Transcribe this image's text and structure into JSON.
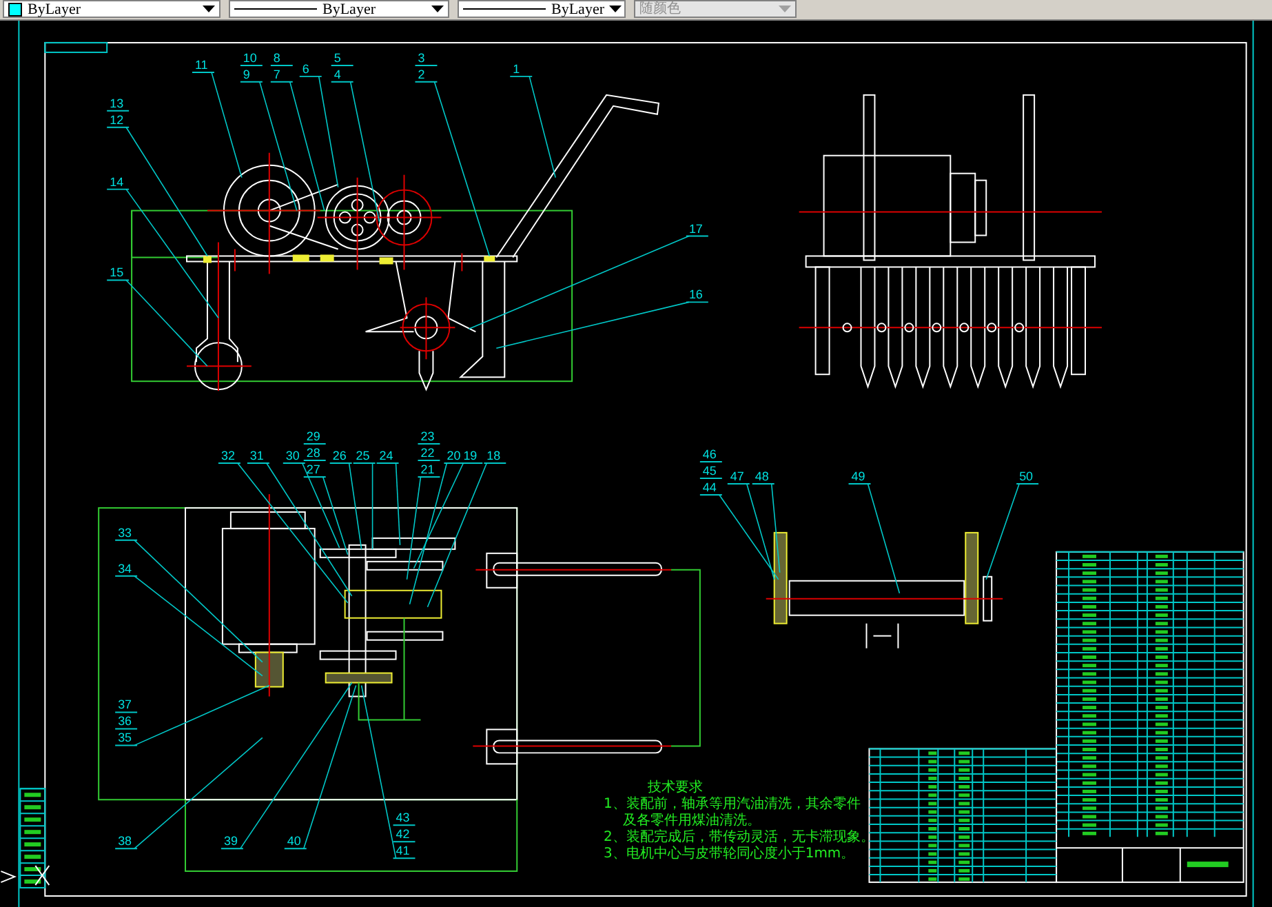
{
  "toolbar": {
    "dropdowns": [
      {
        "kind": "swatch",
        "value": "ByLayer",
        "color": "#00ffff",
        "disabled": false
      },
      {
        "kind": "line",
        "value": "ByLayer",
        "disabled": false
      },
      {
        "kind": "line",
        "value": "ByLayer",
        "disabled": false
      },
      {
        "kind": "plain",
        "value": "随颜色",
        "disabled": true
      }
    ]
  },
  "drawing": {
    "balloons": [
      {
        "numbers": [
          "11"
        ]
      },
      {
        "numbers": [
          "10",
          "9"
        ]
      },
      {
        "numbers": [
          "8",
          "7"
        ]
      },
      {
        "numbers": [
          "6"
        ]
      },
      {
        "numbers": [
          "5",
          "4"
        ]
      },
      {
        "numbers": [
          "3",
          "2"
        ]
      },
      {
        "numbers": [
          "1"
        ]
      },
      {
        "numbers": [
          "13",
          "12"
        ]
      },
      {
        "numbers": [
          "14"
        ]
      },
      {
        "numbers": [
          "15"
        ]
      },
      {
        "numbers": [
          "17"
        ]
      },
      {
        "numbers": [
          "16"
        ]
      },
      {
        "numbers": [
          "32"
        ]
      },
      {
        "numbers": [
          "31"
        ]
      },
      {
        "numbers": [
          "30"
        ]
      },
      {
        "numbers": [
          "29",
          "28",
          "27"
        ]
      },
      {
        "numbers": [
          "26"
        ]
      },
      {
        "numbers": [
          "25"
        ]
      },
      {
        "numbers": [
          "24"
        ]
      },
      {
        "numbers": [
          "23",
          "22",
          "21"
        ]
      },
      {
        "numbers": [
          "20"
        ]
      },
      {
        "numbers": [
          "19"
        ]
      },
      {
        "numbers": [
          "18"
        ]
      },
      {
        "numbers": [
          "33"
        ]
      },
      {
        "numbers": [
          "34"
        ]
      },
      {
        "numbers": [
          "37",
          "36",
          "35"
        ]
      },
      {
        "numbers": [
          "38"
        ]
      },
      {
        "numbers": [
          "39"
        ]
      },
      {
        "numbers": [
          "40"
        ]
      },
      {
        "numbers": [
          "43",
          "42",
          "41"
        ]
      },
      {
        "numbers": [
          "46",
          "45",
          "44"
        ]
      },
      {
        "numbers": [
          "47"
        ]
      },
      {
        "numbers": [
          "48"
        ]
      },
      {
        "numbers": [
          "49"
        ]
      },
      {
        "numbers": [
          "50"
        ]
      }
    ],
    "technical_requirements": {
      "title": "技术要求",
      "lines": [
        "1、装配前，轴承等用汽油清洗，其余零件",
        "及各零件用煤油清洗。",
        "2、装配完成后，带传动灵活，无卡滞现象。",
        "3、电机中心与皮带轮同心度小于1mm。"
      ]
    }
  }
}
